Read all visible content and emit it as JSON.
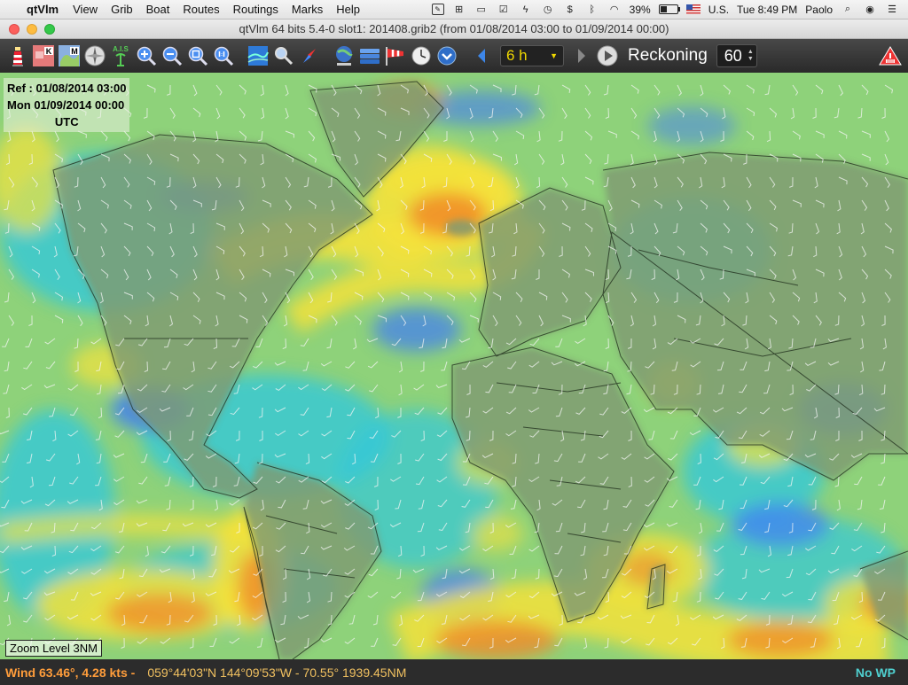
{
  "menubar": {
    "app_name": "qtVlm",
    "menus": [
      "View",
      "Grib",
      "Boat",
      "Routes",
      "Routings",
      "Marks",
      "Help"
    ],
    "battery_pct": "39%",
    "input_source": "U.S.",
    "clock": "Tue 8:49 PM",
    "user": "Paolo"
  },
  "window": {
    "title": "qtVlm 64 bits 5.4-0 slot1: 201408.grib2 (from 01/08/2014 03:00 to 01/09/2014 00:00)"
  },
  "toolbar": {
    "time_step": "6 h",
    "reckoning_label": "Reckoning",
    "reckoning_value": "60",
    "icons": [
      "lighthouse-icon",
      "kap-chart-icon",
      "map-chart-icon",
      "compass-rose-icon",
      "ais-antenna-icon",
      "zoom-in-icon",
      "zoom-out-icon",
      "zoom-fit-icon",
      "zoom-1to1-icon",
      "grib-map-icon",
      "search-icon",
      "compass-needle-icon",
      "boat-globe-icon",
      "layers-icon",
      "wind-sock-icon",
      "clock-icon",
      "sync-icon",
      "step-back-icon",
      "step-forward-icon",
      "play-icon",
      "warning-icon"
    ]
  },
  "map": {
    "ref_line": "Ref : 01/08/2014 03:00",
    "date_line": "Mon 01/09/2014 00:00",
    "tz_line": "UTC",
    "zoom_level": "Zoom Level 3NM"
  },
  "status": {
    "wind": "Wind  63.46°,   4.28 kts  -",
    "position": "059°44'03\"N  144°09'53\"W - 70.55° 1939.45NM",
    "waypoint": "No WP"
  },
  "colors": {
    "wind_low": "#3f7cf5",
    "wind_light": "#34c8d8",
    "wind_mid": "#8ed27a",
    "wind_strong": "#f5e23a",
    "wind_gale": "#f08a2a",
    "land": "#7f9a72"
  }
}
